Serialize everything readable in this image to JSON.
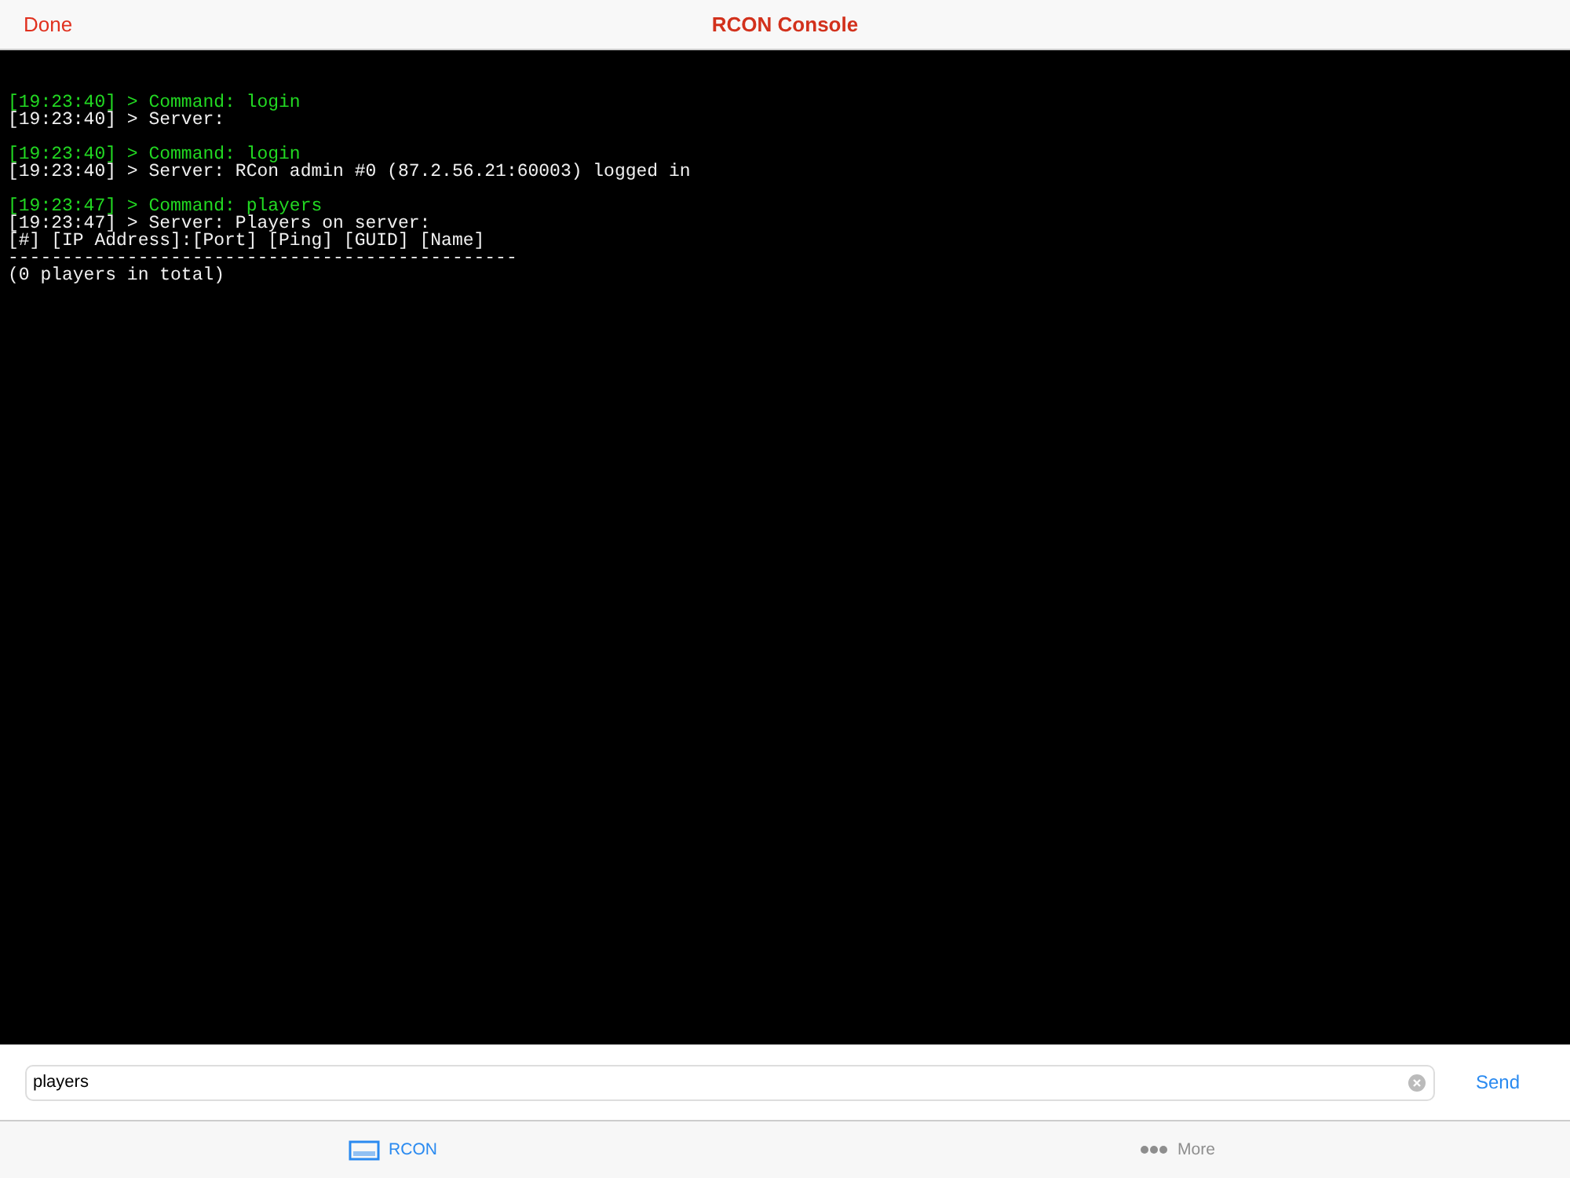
{
  "nav": {
    "left_button": "Done",
    "title": "RCON Console"
  },
  "console": {
    "groups": [
      {
        "lines": [
          {
            "kind": "command",
            "text": "[19:23:40] > Command: login"
          },
          {
            "kind": "server",
            "text": "[19:23:40] > Server:"
          }
        ]
      },
      {
        "lines": [
          {
            "kind": "command",
            "text": "[19:23:40] > Command: login"
          },
          {
            "kind": "server",
            "text": "[19:23:40] > Server: RCon admin #0 (87.2.56.21:60003) logged in"
          }
        ]
      },
      {
        "lines": [
          {
            "kind": "command",
            "text": "[19:23:47] > Command: players"
          },
          {
            "kind": "server",
            "text": "[19:23:47] > Server: Players on server:"
          },
          {
            "kind": "server",
            "text": "[#] [IP Address]:[Port] [Ping] [GUID] [Name]"
          },
          {
            "kind": "server",
            "text": "-----------------------------------------------"
          },
          {
            "kind": "server",
            "text": "(0 players in total)"
          }
        ]
      }
    ]
  },
  "input": {
    "value": "players",
    "send": "Send"
  },
  "tabs": [
    {
      "label": "RCON",
      "selected": true,
      "kind": "console"
    },
    {
      "label": "More",
      "selected": false,
      "kind": "more"
    }
  ]
}
